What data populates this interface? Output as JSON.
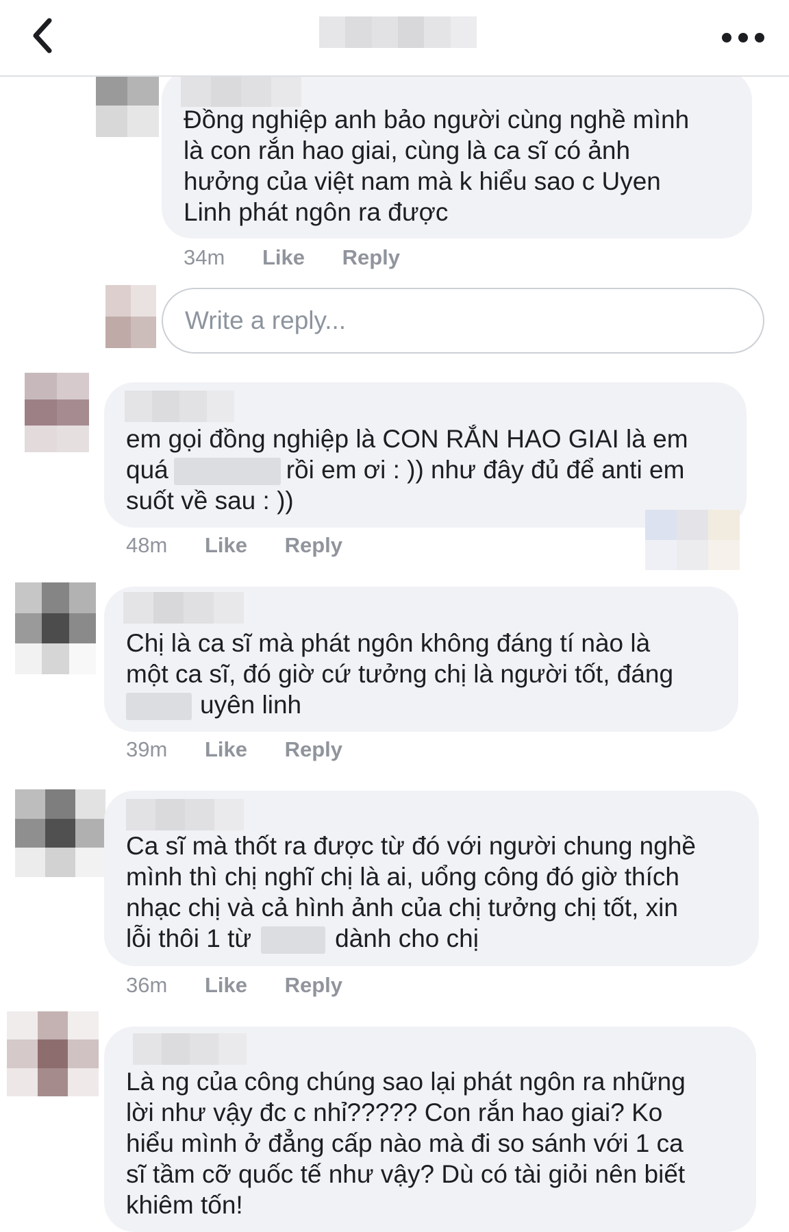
{
  "header": {
    "back_icon": "chevron-left-icon",
    "more_icon": "more-dots-icon"
  },
  "comments": [
    {
      "lines": [
        "Đồng nghiệp anh bảo người cùng nghề mình",
        "là con rắn hao giai, cùng là ca sĩ có ảnh",
        "hưởng của việt nam mà k hiểu sao c Uyen",
        "Linh phát ngôn ra được"
      ],
      "time": "34m",
      "like": "Like",
      "reply": "Reply"
    },
    {
      "lines_a": "em gọi đồng nghiệp là CON RẮN HAO GIAI là em",
      "line_b_pre": "quá",
      "line_b_post": "rồi em ơi : )) như đây đủ để anti em",
      "line_c": "suốt về sau : ))",
      "time": "48m",
      "like": "Like",
      "reply": "Reply"
    },
    {
      "line_a": "Chị là ca sĩ mà phát ngôn không đáng tí nào là",
      "line_b": "một ca sĩ, đó giờ cứ tưởng chị là người tốt, đáng",
      "line_c_post": "uyên linh",
      "time": "39m",
      "like": "Like",
      "reply": "Reply"
    },
    {
      "line_a": "Ca sĩ mà thốt ra được từ đó với người chung nghề",
      "line_b": "mình thì chị nghĩ chị là ai, uổng công đó giờ thích",
      "line_c": "nhạc chị và cả hình ảnh của chị tưởng chị tốt, xin",
      "line_d_pre": "lỗi thôi 1 từ",
      "line_d_post": "dành cho chị",
      "time": "36m",
      "like": "Like",
      "reply": "Reply"
    },
    {
      "lines": [
        "Là ng của công chúng sao lại phát ngôn ra những",
        "lời như vậy đc c nhỉ????? Con rắn hao giai? Ko",
        "hiểu mình ở đẳng cấp nào mà đi so sánh với 1 ca",
        "sĩ tầm cỡ quốc tế như vậy? Dù có tài giỏi nên biết",
        "khiêm tốn!"
      ]
    }
  ],
  "reply_box": {
    "placeholder": "Write a reply..."
  },
  "colors": {
    "bubble": "#f1f2f6",
    "meta": "#90949c",
    "text": "#1c1e21",
    "border": "#ccd0d5"
  }
}
